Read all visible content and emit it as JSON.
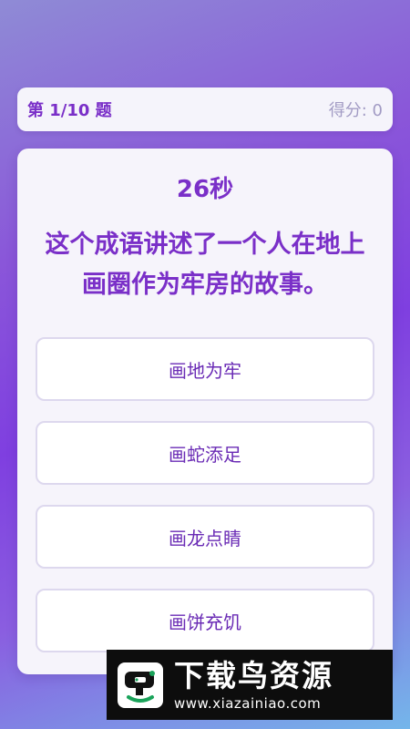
{
  "header": {
    "question_counter": "第 1/10 题",
    "score": "得分: 0"
  },
  "quiz": {
    "timer": "26秒",
    "question": "这个成语讲述了一个人在地上画圈作为牢房的故事。",
    "options": [
      {
        "label": "画地为牢"
      },
      {
        "label": "画蛇添足"
      },
      {
        "label": "画龙点睛"
      },
      {
        "label": "画饼充饥"
      }
    ]
  },
  "watermark": {
    "title": "下载鸟资源",
    "url": "www.xiazainiao.com",
    "logo_icon": "bird-logo-icon"
  },
  "colors": {
    "accent": "#7a2fc8",
    "option_text": "#6a2bb5",
    "muted": "#a29bc4",
    "card_bg": "#f6f4fb",
    "option_border": "#ddd8ee"
  }
}
